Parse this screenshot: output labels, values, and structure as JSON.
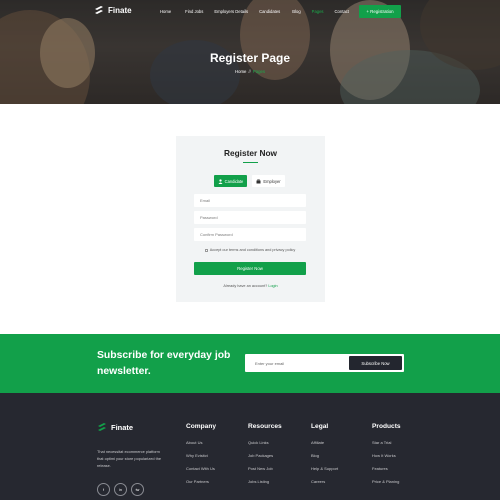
{
  "header": {
    "brand": "Finate",
    "nav": [
      "Home",
      "Find Jobs",
      "Employers Details",
      "Candidates",
      "Blog",
      "Pages",
      "Contact"
    ],
    "active_nav": "Pages",
    "registration_button": "+ Registration"
  },
  "hero": {
    "title": "Register Page",
    "breadcrumb": {
      "home": "Home",
      "separator": "//",
      "current": "Pages"
    }
  },
  "register": {
    "title": "Register Now",
    "roles": [
      {
        "label": "Candidate",
        "icon": "user-icon",
        "selected": true
      },
      {
        "label": "Employer",
        "icon": "briefcase-icon",
        "selected": false
      }
    ],
    "fields": [
      {
        "placeholder": "Email",
        "value": ""
      },
      {
        "placeholder": "Password",
        "value": ""
      },
      {
        "placeholder": "Confirm Password",
        "value": ""
      }
    ],
    "terms": "Accept our terms and conditions and privacy policy",
    "submit_label": "Register Now",
    "login_prompt": "Already have an account?",
    "login_link": "Login"
  },
  "subscribe": {
    "heading": "Subscribe for everyday job newsletter.",
    "email_placeholder": "Enter your email",
    "button": "Subscribe Now"
  },
  "footer": {
    "brand": "Finate",
    "description": "That necessitat ecommerce platform that optimi your store popularized the release.",
    "socials": [
      "f",
      "in",
      "tw"
    ],
    "columns": [
      {
        "title": "Company",
        "items": [
          "About Us",
          "Why Evisitct",
          "Contact With Us",
          "Our Partners"
        ]
      },
      {
        "title": "Resources",
        "items": [
          "Quick Links",
          "Job Packages",
          "Post New Job",
          "Jobs Listing"
        ]
      },
      {
        "title": "Legal",
        "items": [
          "Affiliate",
          "Blog",
          "Help & Support",
          "Careers"
        ]
      },
      {
        "title": "Products",
        "items": [
          "Star a Trial",
          "How It Works",
          "Features",
          "Price & Planing"
        ]
      }
    ]
  },
  "colors": {
    "accent": "#12a04a",
    "footer_bg": "#262830",
    "card_bg": "#f2f4f5"
  }
}
